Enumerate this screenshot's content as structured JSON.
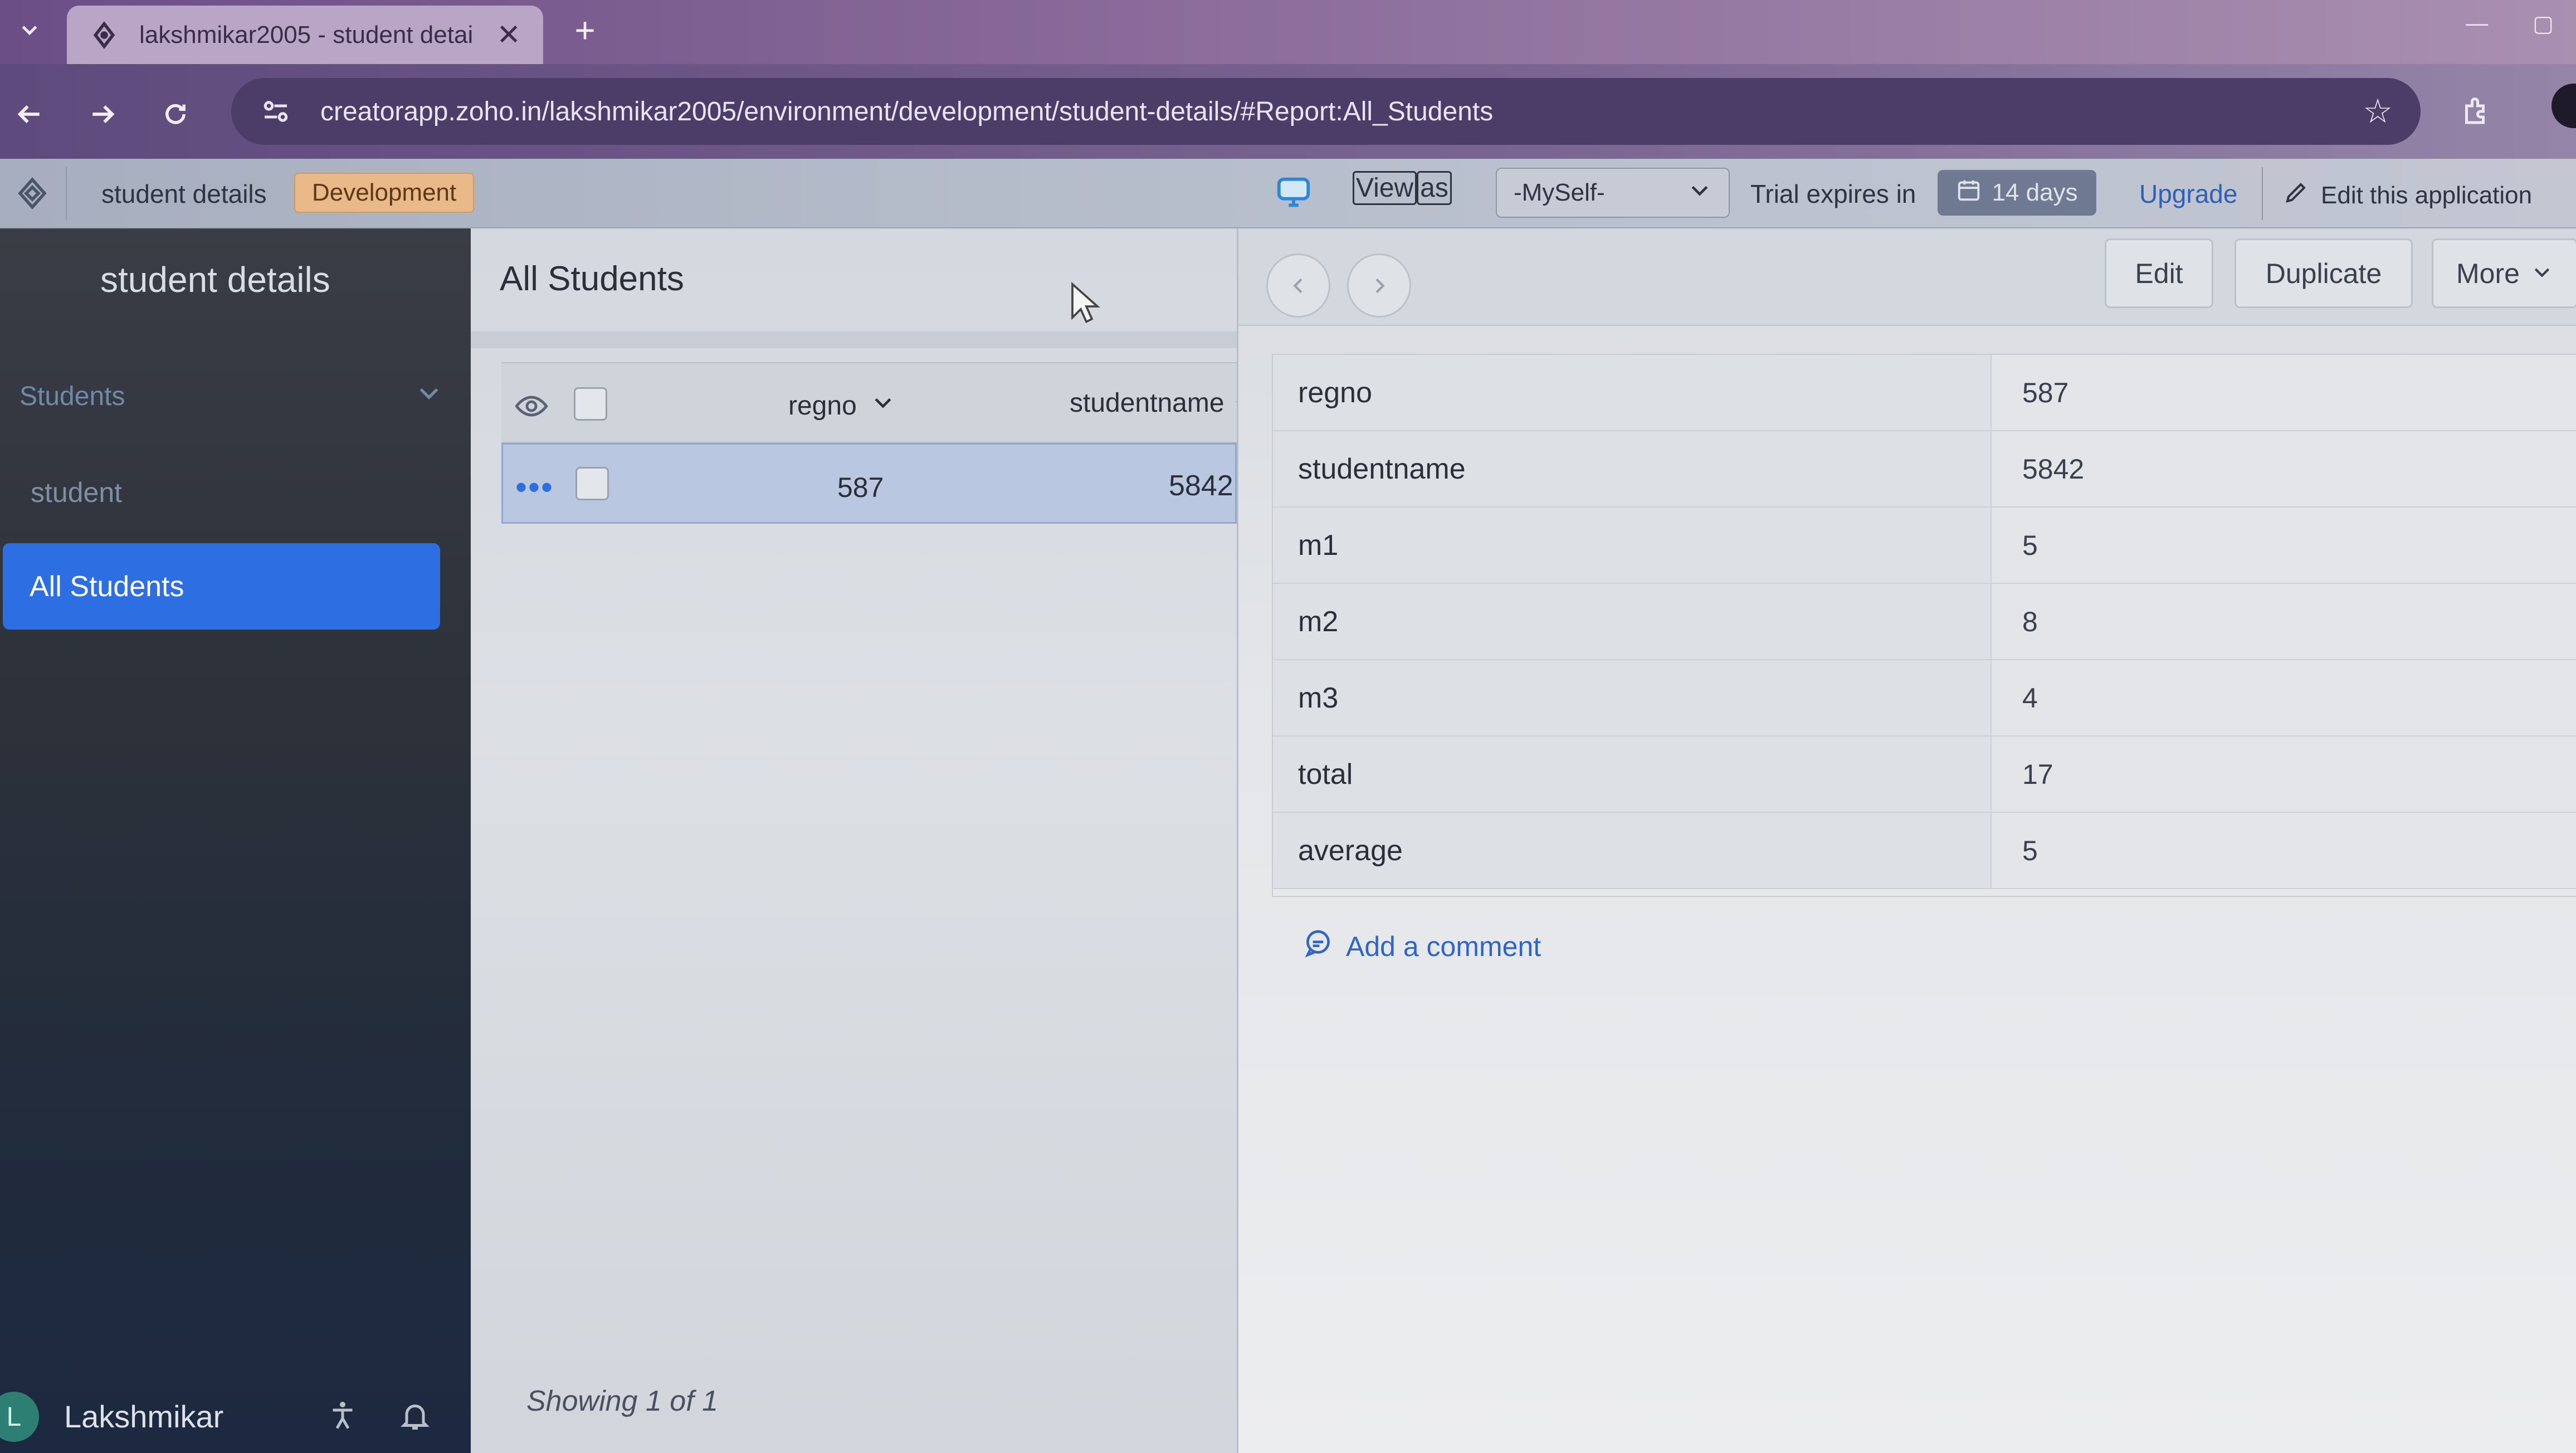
{
  "browser": {
    "tab_title": "lakshmikar2005 - student detai",
    "tab_close": "✕",
    "new_tab": "+",
    "url": "creatorapp.zoho.in/lakshmikar2005/environment/development/student-details/#Report:All_Students"
  },
  "app_header": {
    "app_name": "student details",
    "environment": "Development",
    "view_as_label_pre": "View",
    "view_as_label_post": "as",
    "view_as_value": "-MySelf-",
    "trial_text": "Trial expires in",
    "trial_days": "14 days",
    "upgrade": "Upgrade",
    "edit_app": "Edit this application"
  },
  "sidebar": {
    "title": "student details",
    "section": "Students",
    "items": [
      {
        "label": "student",
        "active": false
      },
      {
        "label": "All Students",
        "active": true
      }
    ],
    "user_initial": "L",
    "user_name": "Lakshmikar"
  },
  "report": {
    "title": "All Students",
    "columns": [
      "regno",
      "studentname"
    ],
    "rows": [
      {
        "regno": "587",
        "studentname": "5842"
      }
    ],
    "footer": "Showing 1 of 1"
  },
  "detail": {
    "buttons": {
      "edit": "Edit",
      "duplicate": "Duplicate",
      "more": "More"
    },
    "fields": [
      {
        "label": "regno",
        "value": "587"
      },
      {
        "label": "studentname",
        "value": "5842"
      },
      {
        "label": "m1",
        "value": "5"
      },
      {
        "label": "m2",
        "value": "8"
      },
      {
        "label": "m3",
        "value": "4"
      },
      {
        "label": "total",
        "value": "17"
      },
      {
        "label": "average",
        "value": "5"
      }
    ],
    "add_comment": "Add a comment"
  },
  "colors": {
    "accent": "#2d6fe3",
    "env_badge": "#e9b98a",
    "sidebar_bg": "#2e323a",
    "link": "#2f66c4"
  },
  "icons": [
    "chevron-down-icon",
    "zoho-logo-icon",
    "close-icon",
    "plus-icon",
    "back-arrow-icon",
    "forward-arrow-icon",
    "reload-icon",
    "site-info-icon",
    "star-icon",
    "extensions-icon",
    "monitor-icon",
    "calendar-icon",
    "pencil-icon",
    "eye-icon",
    "ellipsis-icon",
    "chevron-left-icon",
    "chevron-right-icon",
    "accessibility-icon",
    "bell-icon",
    "comment-icon",
    "cursor-icon"
  ]
}
